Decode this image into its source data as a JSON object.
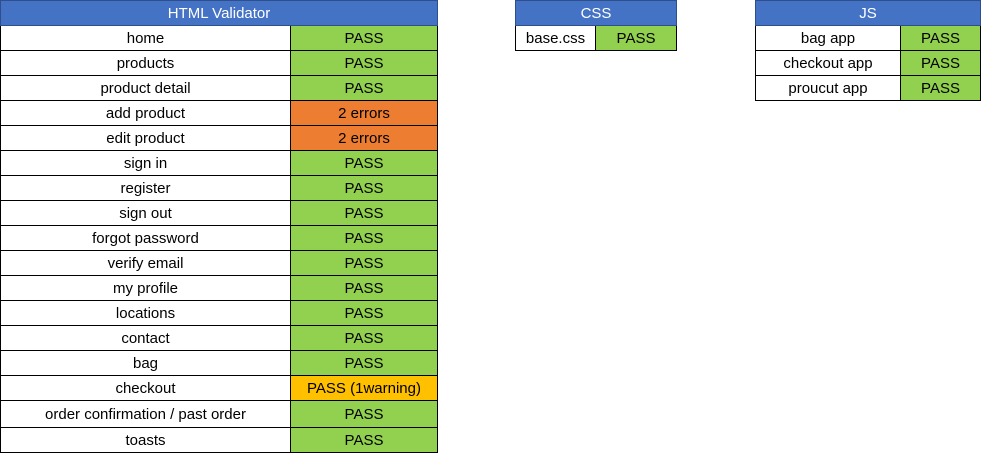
{
  "colors": {
    "header": "#4472c4",
    "pass": "#92d050",
    "error": "#ed7d31",
    "warning": "#ffc000"
  },
  "html_validator": {
    "title": "HTML Validator",
    "rows": [
      {
        "page": "home",
        "result": "PASS",
        "status": "pass"
      },
      {
        "page": "products",
        "result": "PASS",
        "status": "pass"
      },
      {
        "page": "product detail",
        "result": "PASS",
        "status": "pass"
      },
      {
        "page": "add product",
        "result": "2 errors",
        "status": "err"
      },
      {
        "page": "edit product",
        "result": "2 errors",
        "status": "err"
      },
      {
        "page": "sign in",
        "result": "PASS",
        "status": "pass"
      },
      {
        "page": "register",
        "result": "PASS",
        "status": "pass"
      },
      {
        "page": "sign out",
        "result": "PASS",
        "status": "pass"
      },
      {
        "page": "forgot password",
        "result": "PASS",
        "status": "pass"
      },
      {
        "page": "verify email",
        "result": "PASS",
        "status": "pass"
      },
      {
        "page": "my profile",
        "result": "PASS",
        "status": "pass"
      },
      {
        "page": "locations",
        "result": "PASS",
        "status": "pass"
      },
      {
        "page": "contact",
        "result": "PASS",
        "status": "pass"
      },
      {
        "page": "bag",
        "result": "PASS",
        "status": "pass"
      },
      {
        "page": "checkout",
        "result": "PASS (1warning)",
        "status": "warn"
      },
      {
        "page": "order confirmation / past order",
        "result": "PASS",
        "status": "pass"
      },
      {
        "page": "toasts",
        "result": "PASS",
        "status": "pass"
      }
    ]
  },
  "css_validator": {
    "title": "CSS",
    "rows": [
      {
        "file": "base.css",
        "result": "PASS",
        "status": "pass"
      }
    ]
  },
  "js_validator": {
    "title": "JS",
    "rows": [
      {
        "file": "bag app",
        "result": "PASS",
        "status": "pass"
      },
      {
        "file": "checkout app",
        "result": "PASS",
        "status": "pass"
      },
      {
        "file": "proucut app",
        "result": "PASS",
        "status": "pass"
      }
    ]
  }
}
